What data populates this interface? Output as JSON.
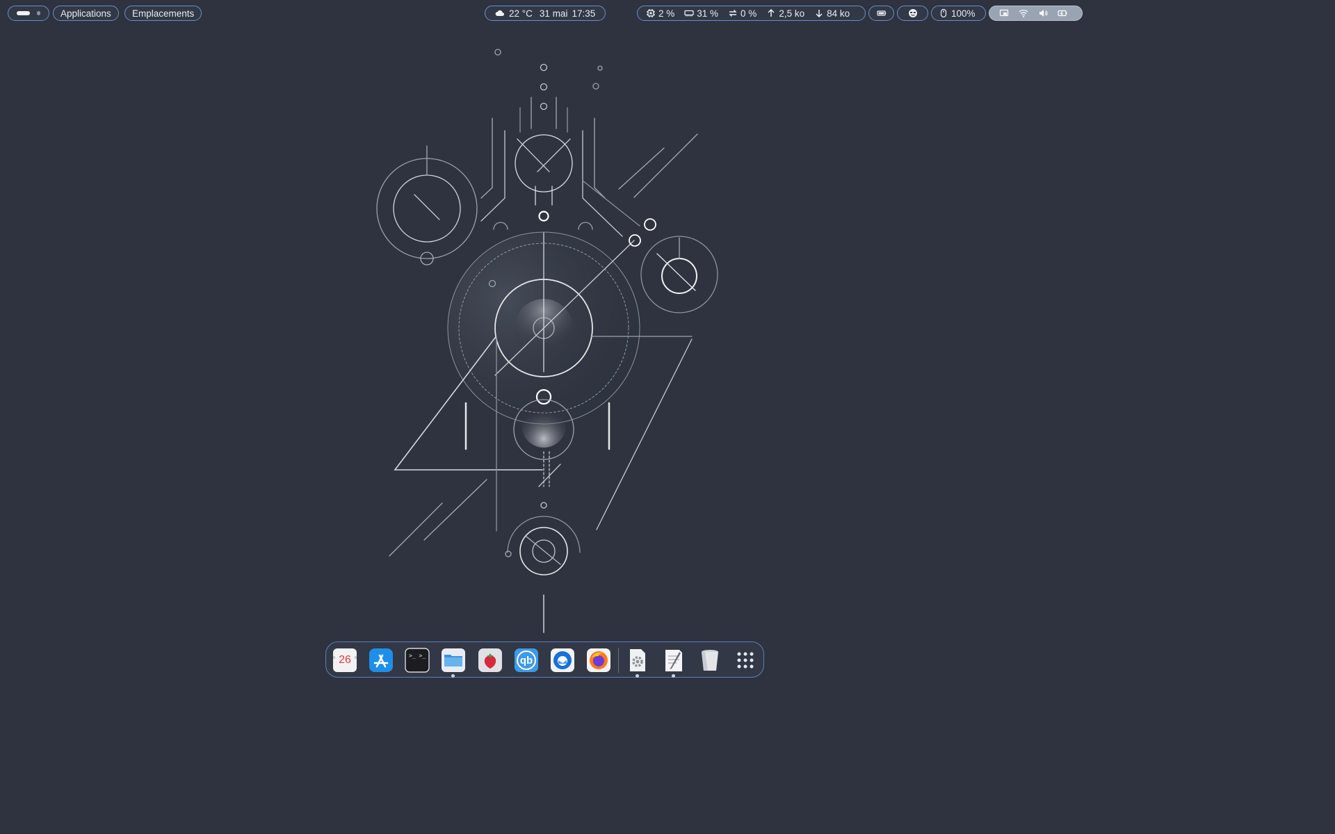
{
  "topbar": {
    "left": {
      "activities_icon": "workspace-indicator-icon",
      "applications_label": "Applications",
      "places_label": "Emplacements"
    },
    "center": {
      "weather_icon": "cloud-icon",
      "temperature": "22 °C",
      "date": "31 mai",
      "time": "17:35"
    },
    "system_monitor": {
      "cpu_icon": "cpu-icon",
      "cpu": "2 %",
      "memory_icon": "memory-icon",
      "memory": "31 %",
      "swap_icon": "swap-icon",
      "swap": "0 %",
      "upload_icon": "arrow-up-icon",
      "upload": "2,5 ko",
      "download_icon": "arrow-down-icon",
      "download": "84 ko"
    },
    "battery_icon": "battery-icon",
    "user_icon": "emoji-face-icon",
    "mouse_icon": "mouse-icon",
    "mouse_battery": "100%",
    "status_icons": [
      "screen-icon",
      "wifi-icon",
      "volume-icon",
      "battery-charging-icon"
    ]
  },
  "dock": {
    "items": [
      {
        "name": "calendar",
        "icon": "calendar-icon",
        "label": "26"
      },
      {
        "name": "app-store",
        "icon": "app-store-icon"
      },
      {
        "name": "terminal",
        "icon": "terminal-icon",
        "label": ">_ >_"
      },
      {
        "name": "files",
        "icon": "folder-icon"
      },
      {
        "name": "strawberry",
        "icon": "strawberry-icon"
      },
      {
        "name": "qbittorrent",
        "icon": "qbittorrent-icon",
        "label": "qb"
      },
      {
        "name": "thunderbird",
        "icon": "thunderbird-icon"
      },
      {
        "name": "firefox",
        "icon": "firefox-icon"
      },
      {
        "name": "settings",
        "icon": "settings-icon"
      },
      {
        "name": "text-editor",
        "icon": "text-editor-icon"
      },
      {
        "name": "trash",
        "icon": "trash-icon"
      },
      {
        "name": "app-grid",
        "icon": "app-grid-icon"
      }
    ],
    "colors": {
      "accent": "#5b7fbf",
      "background": "#2e333f"
    }
  }
}
